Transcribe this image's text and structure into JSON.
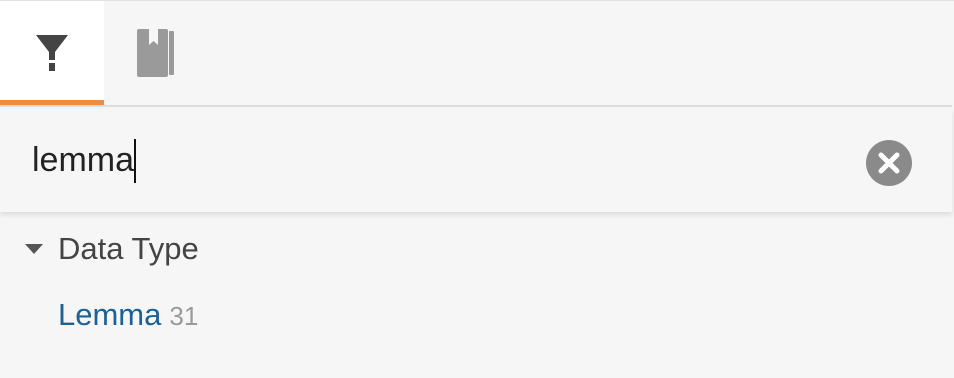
{
  "tabs": [
    {
      "name": "filter",
      "icon": "filter-icon",
      "active": true
    },
    {
      "name": "bookmarks",
      "icon": "bookmarks-icon",
      "active": false
    }
  ],
  "search": {
    "value": "lemma"
  },
  "facets": [
    {
      "title": "Data Type",
      "expanded": true,
      "items": [
        {
          "label": "Lemma",
          "count": "31"
        }
      ]
    }
  ],
  "colors": {
    "accent": "#f08a3c",
    "link": "#1d6096",
    "icon": "#6e6e6e",
    "count": "#9a9a9a"
  }
}
